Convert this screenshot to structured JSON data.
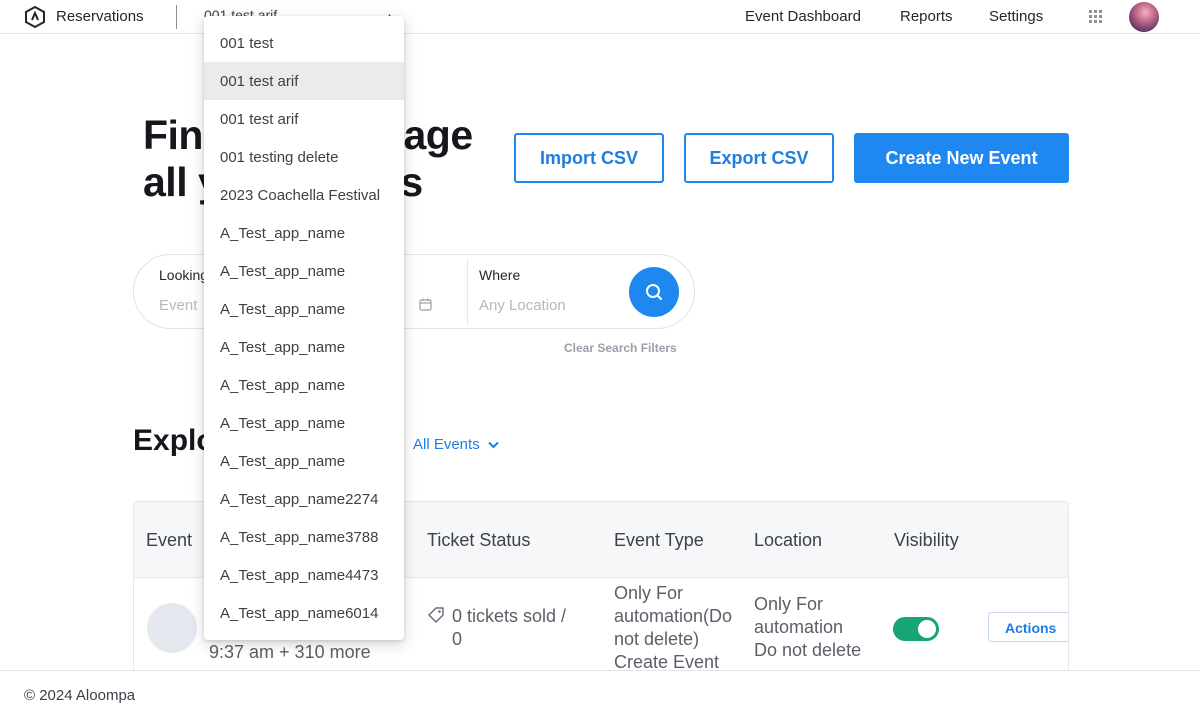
{
  "nav": {
    "app_title": "Reservations",
    "selected_app": "001 test arif",
    "links": [
      "Event Dashboard",
      "Reports",
      "Settings"
    ]
  },
  "hero": {
    "title_line1": "Find and manage",
    "title_line2": "all your events",
    "import_label": "Import CSV",
    "export_label": "Export CSV",
    "create_label": "Create New Event"
  },
  "search": {
    "looking_label": "Looking for",
    "looking_placeholder": "Event",
    "where_label": "Where",
    "where_placeholder": "Any Location",
    "clear_label": "Clear Search Filters"
  },
  "explore": {
    "title": "Explore",
    "filter_label": "All Events"
  },
  "table": {
    "headers": [
      "Event",
      "Ticket Status",
      "Event Type",
      "Location",
      "Visibility"
    ],
    "row": {
      "date_text": "9:37 am + 310 more",
      "tickets_line1": "0 tickets sold /",
      "tickets_line2": "0",
      "type_lines": [
        "Only For",
        "automation(Do",
        "not delete)",
        "Create Event"
      ],
      "location_lines": [
        "Only For",
        "automation",
        "Do not delete"
      ],
      "visibility_on": true,
      "actions_label": "Actions"
    }
  },
  "dropdown": {
    "selected_index": 1,
    "options": [
      "001 test",
      "001 test arif",
      "001 test arif",
      "001 testing delete",
      "2023 Coachella Festival",
      "A_Test_app_name",
      "A_Test_app_name",
      "A_Test_app_name",
      "A_Test_app_name",
      "A_Test_app_name",
      "A_Test_app_name",
      "A_Test_app_name",
      "A_Test_app_name2274",
      "A_Test_app_name3788",
      "A_Test_app_name4473",
      "A_Test_app_name6014"
    ]
  },
  "footer": {
    "text": "© 2024 Aloompa"
  },
  "colors": {
    "accent": "#1e88f0",
    "toggle_on": "#17a673"
  }
}
